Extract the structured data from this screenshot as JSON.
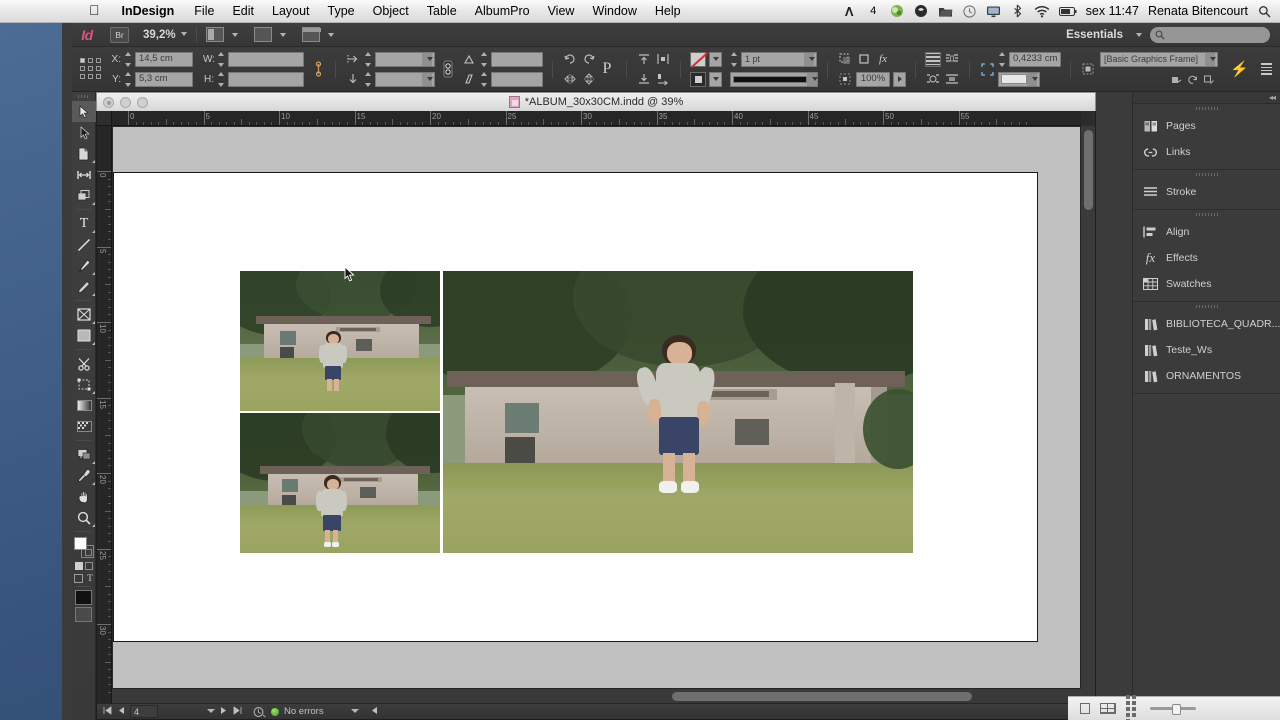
{
  "menubar": {
    "apple_icon": "apple-icon",
    "app_name": "InDesign",
    "items": [
      "File",
      "Edit",
      "Layout",
      "Type",
      "Object",
      "Table",
      "AlbumPro",
      "View",
      "Window",
      "Help"
    ],
    "status_icons": [
      "adobe-cc-count-icon",
      "adobe-cc-icon",
      "dropbox-icon",
      "folder-icon",
      "time-machine-icon",
      "display-icon",
      "bluetooth-icon",
      "wifi-icon",
      "battery-icon"
    ],
    "cc_count": "4",
    "clock": "sex 11:47",
    "user": "Renata Bitencourt",
    "spotlight_icon": "search-icon"
  },
  "appbar": {
    "logo": "Id",
    "bridge_label": "Br",
    "zoom_level": "39,2%",
    "view_mode_icons": [
      "screen-mode-icon",
      "view-options-icon",
      "arrange-documents-icon"
    ],
    "workspace": "Essentials",
    "search_placeholder": ""
  },
  "control": {
    "reference_point_label": "reference-point-proxy",
    "x_label": "X:",
    "x_value": "14,5 cm",
    "y_label": "Y:",
    "y_value": "5,3 cm",
    "w_label": "W:",
    "w_value": "",
    "h_label": "H:",
    "h_value": "",
    "constrain_icon": "constrain-proportions-icon",
    "scale_x_value": "",
    "scale_y_value": "",
    "shear_value": "",
    "rotate_value": "",
    "stroke_weight": "1 pt",
    "opacity": "100%",
    "corner_radius": "0,4233 cm",
    "object_style": "[Basic Graphics Frame]",
    "fill_swatch": "none-swatch-icon",
    "stroke_swatch": "black-stroke-swatch-icon",
    "quick_apply_icon": "quick-apply-icon",
    "panel_menu_icon": "panel-menu-icon"
  },
  "document": {
    "title": "*ALBUM_30x30CM.indd @ 39%",
    "icon": "indesign-document-icon",
    "ruler_units": "cm",
    "ruler_h_labels": [
      "0",
      "5",
      "10",
      "15",
      "20",
      "25",
      "30",
      "35",
      "40",
      "45",
      "50",
      "55"
    ],
    "ruler_v_labels": [
      "0",
      "5",
      "10",
      "15",
      "20",
      "25",
      "30"
    ]
  },
  "status": {
    "first_page_icon": "first-page-icon",
    "prev_page_icon": "previous-page-icon",
    "page_number": "4",
    "page_dropdown_icon": "chevron-down-icon",
    "next_page_icon": "next-page-icon",
    "last_page_icon": "last-page-icon",
    "preflight_icon": "preflight-icon",
    "preflight_status": "No errors",
    "preflight_dropdown_icon": "chevron-down-icon",
    "preflight_color": "#4caf28"
  },
  "tools": {
    "items": [
      {
        "name": "selection-tool",
        "glyph": "select",
        "selected": true
      },
      {
        "name": "direct-selection-tool",
        "glyph": "direct"
      },
      {
        "name": "page-tool",
        "glyph": "page"
      },
      {
        "name": "gap-tool",
        "glyph": "gap"
      },
      {
        "name": "content-collector-tool",
        "glyph": "collector"
      },
      {
        "name": "type-tool",
        "glyph": "T"
      },
      {
        "name": "line-tool",
        "glyph": "line"
      },
      {
        "name": "pen-tool",
        "glyph": "pen"
      },
      {
        "name": "pencil-tool",
        "glyph": "pencil"
      },
      {
        "name": "rectangle-frame-tool",
        "glyph": "frame"
      },
      {
        "name": "rectangle-tool",
        "glyph": "rect"
      },
      {
        "name": "scissors-tool",
        "glyph": "scissors"
      },
      {
        "name": "free-transform-tool",
        "glyph": "transform"
      },
      {
        "name": "gradient-swatch-tool",
        "glyph": "gradient"
      },
      {
        "name": "gradient-feather-tool",
        "glyph": "feather"
      },
      {
        "name": "note-tool",
        "glyph": "note"
      },
      {
        "name": "eyedropper-tool",
        "glyph": "eyedropper"
      },
      {
        "name": "hand-tool",
        "glyph": "hand"
      },
      {
        "name": "zoom-tool",
        "glyph": "zoom"
      }
    ],
    "fill_color": "#ffffff",
    "stroke_color": "#000000",
    "apply_none_icon": "apply-none-icon",
    "formatting_text_icon": "formatting-affects-text-icon",
    "normal_mode_icon": "normal-view-mode-icon",
    "preview_mode_icon": "preview-mode-icon"
  },
  "dock": {
    "collapse_icon": "collapse-panels-icon",
    "groups": [
      {
        "items": [
          {
            "label": "Pages",
            "icon": "pages-icon"
          },
          {
            "label": "Links",
            "icon": "links-icon"
          }
        ]
      },
      {
        "items": [
          {
            "label": "Stroke",
            "icon": "stroke-icon"
          }
        ]
      },
      {
        "items": [
          {
            "label": "Align",
            "icon": "align-icon"
          },
          {
            "label": "Effects",
            "icon": "effects-icon"
          },
          {
            "label": "Swatches",
            "icon": "swatches-icon"
          }
        ]
      },
      {
        "items": [
          {
            "label": "BIBLIOTECA_QUADR...",
            "icon": "library-icon"
          },
          {
            "label": "Teste_Ws",
            "icon": "library-icon"
          },
          {
            "label": "ORNAMENTOS",
            "icon": "library-icon"
          }
        ]
      }
    ]
  },
  "layout": {
    "photos": [
      {
        "name": "photo-top-left",
        "desc": "boy standing in field before concrete building"
      },
      {
        "name": "photo-bottom-left",
        "desc": "boy walking in field before concrete building"
      },
      {
        "name": "photo-right-large",
        "desc": "boy running in field before concrete building"
      }
    ]
  },
  "colors": {
    "ui_dark": "#3b3b3b",
    "panel_dark": "#383838",
    "accent_pink": "#e0547c",
    "canvas_gray": "#c0c0c0",
    "page_white": "#fefefe",
    "desktop_blue": "#36537b"
  }
}
